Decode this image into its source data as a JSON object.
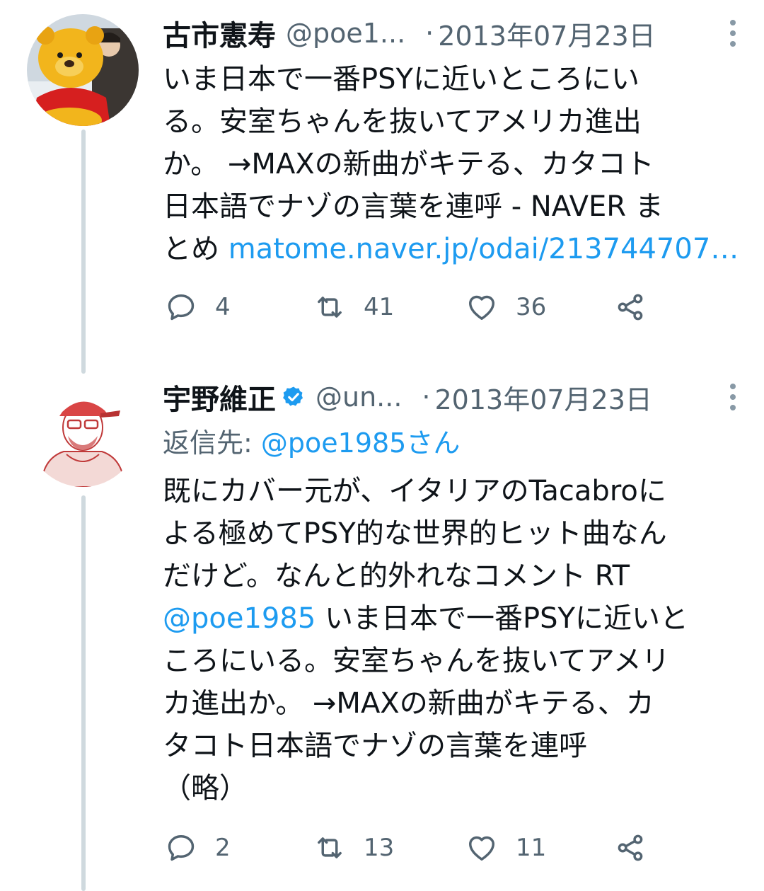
{
  "tweets": [
    {
      "display_name": "古市憲寿",
      "handle": "@poe1...",
      "separator": "·",
      "date": "2013年07月23日",
      "verified": false,
      "text_lines": [
        "いま日本で一番PSYに近いところにい",
        "る。安室ちゃんを抜いてアメリカ進出",
        "か。 →MAXの新曲がキテる、カタコト",
        "日本語でナゾの言葉を連呼 - NAVER ま"
      ],
      "last_line_prefix": "とめ",
      "link": "matome.naver.jp/odai/213744707…",
      "replies": "4",
      "retweets": "41",
      "likes": "36"
    },
    {
      "display_name": "宇野維正",
      "handle": "@un...",
      "separator": "·",
      "date": "2013年07月23日",
      "verified": true,
      "reply_label": "返信先:",
      "reply_mention": "@poe1985さん",
      "text_lines": [
        "既にカバー元が、イタリアのTacabroに",
        "よる極めてPSY的な世界的ヒット曲なん",
        "だけど。なんと的外れなコメント RT"
      ],
      "mention": "@poe1985",
      "after_mention": " いま日本で一番PSYに近いと",
      "text_lines_after": [
        "ころにいる。安室ちゃんを抜いてアメリ",
        "カ進出か。 →MAXの新曲がキテる、カ",
        "タコト日本語でナゾの言葉を連呼",
        "（略）"
      ],
      "replies": "2",
      "retweets": "13",
      "likes": "11"
    }
  ],
  "colors": {
    "link": "#1d9bf0",
    "secondary": "#536471",
    "icon": "#536471",
    "thread_line": "#cfd9de"
  },
  "icons": [
    "reply-icon",
    "retweet-icon",
    "like-icon",
    "share-icon",
    "more-icon",
    "verified-badge-icon"
  ]
}
